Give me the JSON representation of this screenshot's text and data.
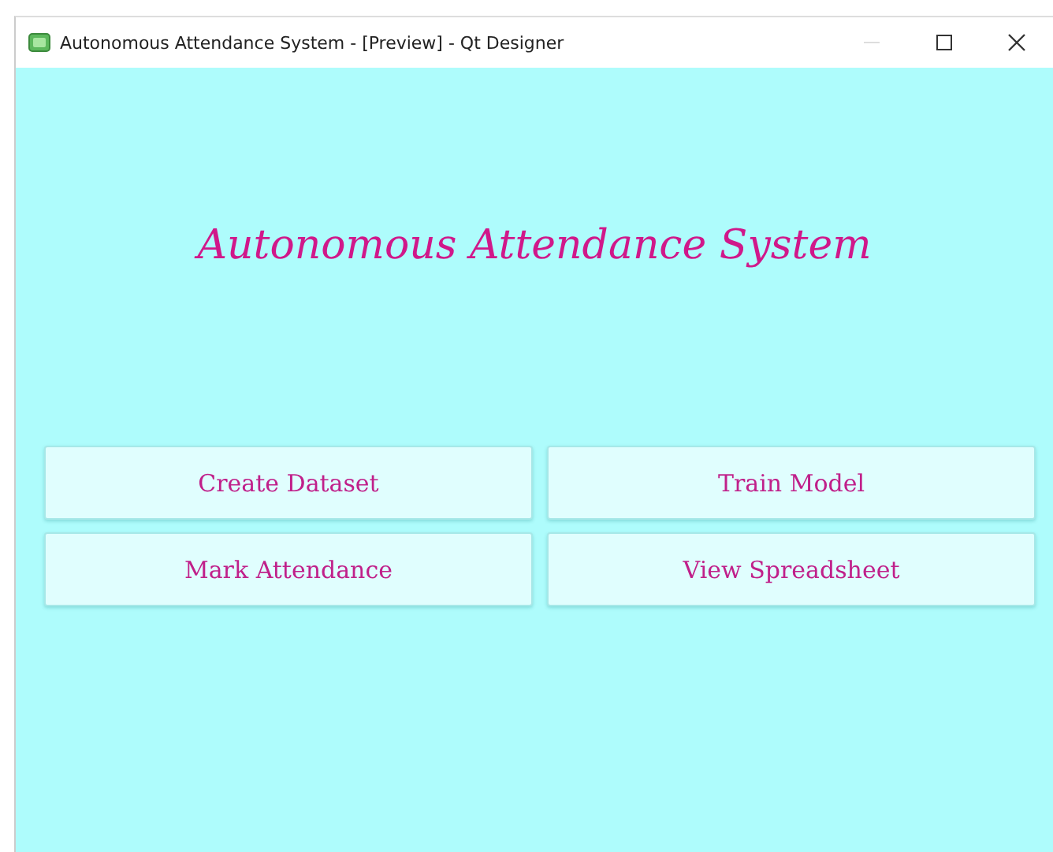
{
  "window": {
    "title": "Autonomous Attendance System - [Preview] - Qt Designer"
  },
  "heading": "Autonomous Attendance System",
  "buttons": [
    {
      "label": "Create Dataset"
    },
    {
      "label": "Train Model"
    },
    {
      "label": "Mark Attendance"
    },
    {
      "label": "View Spreadsheet"
    }
  ]
}
